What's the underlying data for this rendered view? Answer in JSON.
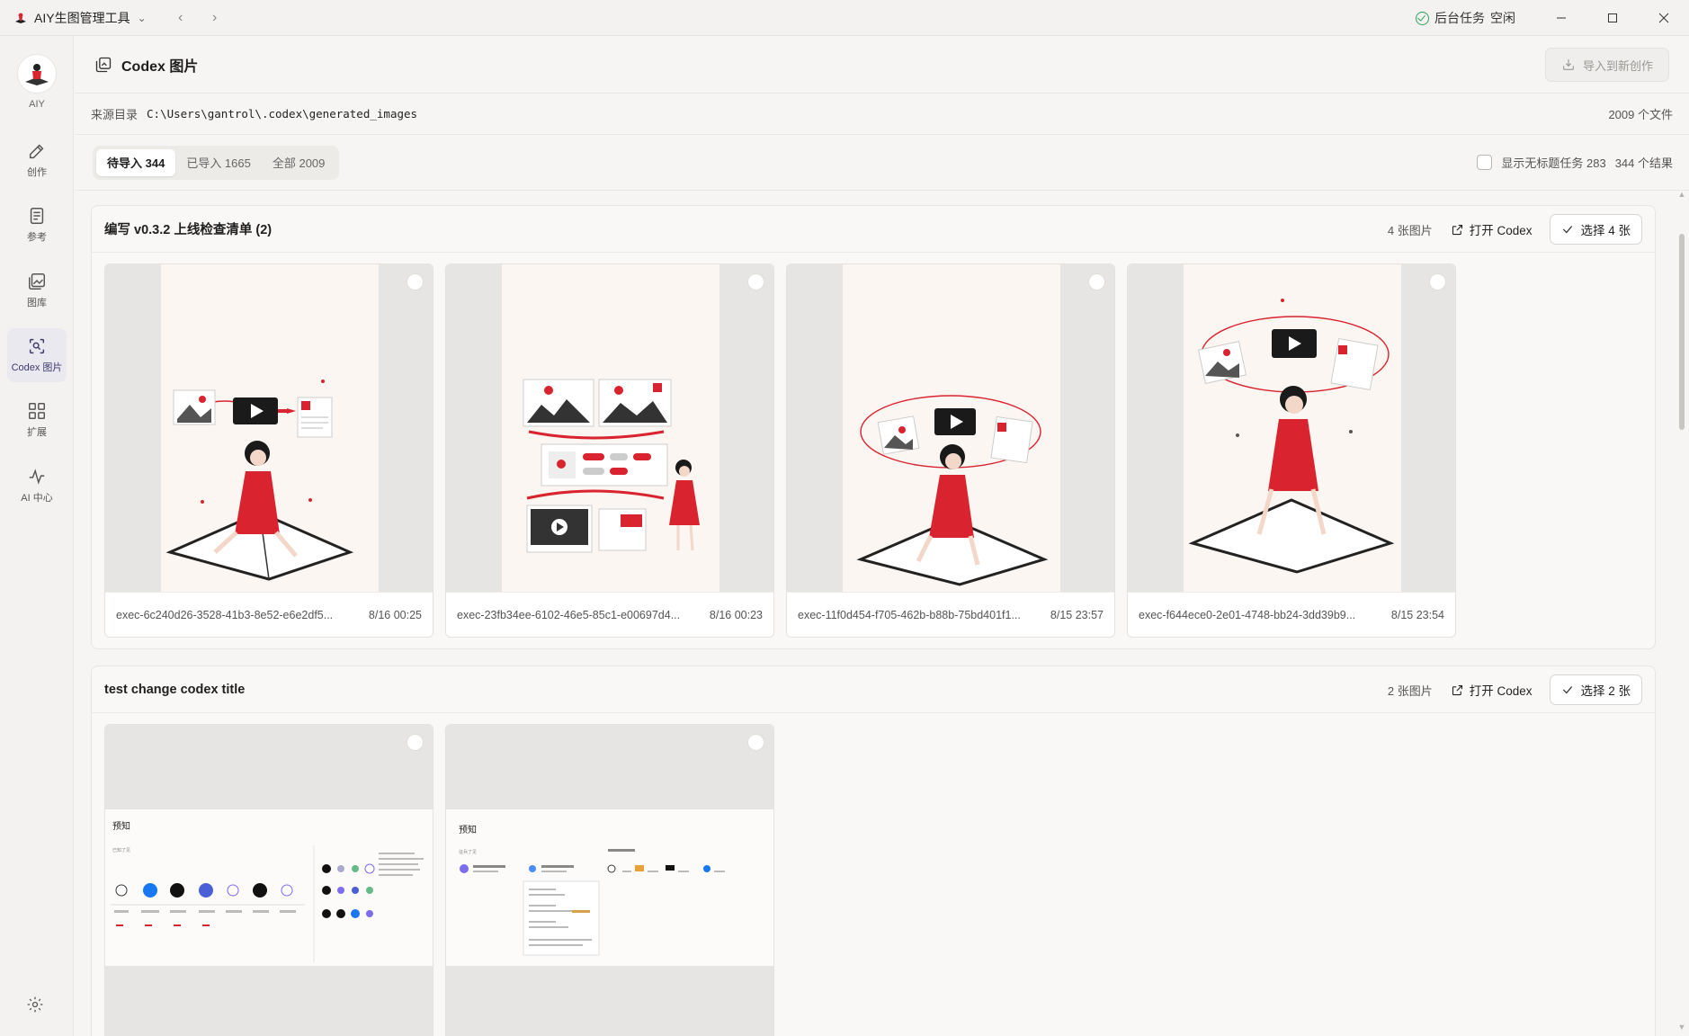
{
  "app": {
    "title": "AIY生图管理工具",
    "status_label": "后台任务",
    "status_value": "空闲"
  },
  "sidebar": {
    "avatar_label": "AIY",
    "items": [
      {
        "label": "创作",
        "icon": "edit-icon"
      },
      {
        "label": "参考",
        "icon": "document-icon"
      },
      {
        "label": "图库",
        "icon": "gallery-icon"
      },
      {
        "label": "Codex 图片",
        "icon": "codex-image-icon",
        "active": true
      },
      {
        "label": "扩展",
        "icon": "extension-icon"
      },
      {
        "label": "AI 中心",
        "icon": "pulse-icon"
      }
    ]
  },
  "header": {
    "title": "Codex 图片",
    "import_label": "导入到新创作"
  },
  "source": {
    "label": "来源目录",
    "path": "C:\\Users\\gantrol\\.codex\\generated_images",
    "count": "2009 个文件"
  },
  "filters": {
    "tabs": [
      {
        "label": "待导入 344",
        "active": true
      },
      {
        "label": "已导入 1665"
      },
      {
        "label": "全部 2009"
      }
    ],
    "untitled_label": "显示无标题任务 283",
    "result_count": "344 个结果"
  },
  "groups": [
    {
      "title": "编写 v0.3.2 上线检查清单 (2)",
      "count": "4 张图片",
      "open_label": "打开 Codex",
      "select_label": "选择 4 张",
      "cards": [
        {
          "name": "exec-6c240d26-3528-41b3-8e52-e6e2df5...",
          "time": "8/16 00:25"
        },
        {
          "name": "exec-23fb34ee-6102-46e5-85c1-e00697d4...",
          "time": "8/16 00:23"
        },
        {
          "name": "exec-11f0d454-f705-462b-b88b-75bd401f1...",
          "time": "8/15 23:57"
        },
        {
          "name": "exec-f644ece0-2e01-4748-bb24-3dd39b9...",
          "time": "8/15 23:54"
        }
      ]
    },
    {
      "title": "test change codex title",
      "count": "2 张图片",
      "open_label": "打开 Codex",
      "select_label": "选择 2 张",
      "cards": [
        {
          "heading": "预知",
          "sub": "已知了见"
        },
        {
          "heading": "预知",
          "sub": "征兵了见"
        }
      ]
    }
  ],
  "colors": {
    "accent_red": "#d9232e",
    "sidebar_active": "#ebe9f0",
    "status_green": "#2e9f5e"
  }
}
